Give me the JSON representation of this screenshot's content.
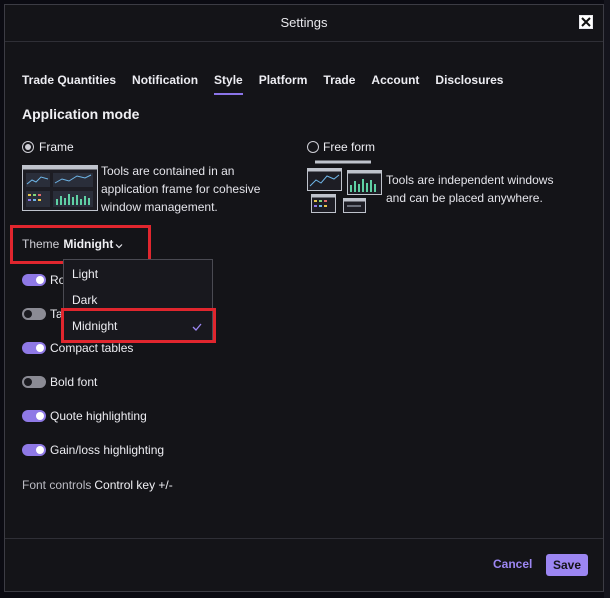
{
  "window": {
    "title": "Settings",
    "close_icon": "close-icon"
  },
  "tabs": [
    {
      "label": "Trade Quantities",
      "active": false
    },
    {
      "label": "Notification",
      "active": false
    },
    {
      "label": "Style",
      "active": true
    },
    {
      "label": "Platform",
      "active": false
    },
    {
      "label": "Trade",
      "active": false
    },
    {
      "label": "Account",
      "active": false
    },
    {
      "label": "Disclosures",
      "active": false
    }
  ],
  "application_mode": {
    "heading": "Application mode",
    "frame": {
      "label": "Frame",
      "selected": true,
      "description_lines": [
        "Tools are contained in an",
        "application frame for cohesive",
        "window management."
      ]
    },
    "free_form": {
      "label": "Free form",
      "selected": false,
      "description_lines": [
        "Tools are independent windows",
        "and can be placed anywhere."
      ]
    }
  },
  "theme": {
    "label": "Theme",
    "value": "Midnight",
    "options": [
      "Light",
      "Dark",
      "Midnight"
    ],
    "selected_option": "Midnight"
  },
  "toggles": [
    {
      "label": "Ro",
      "on": true
    },
    {
      "label": "Ta",
      "on": false
    },
    {
      "label": "Compact tables",
      "on": true
    },
    {
      "label": "Bold font",
      "on": false
    },
    {
      "label": "Quote highlighting",
      "on": true
    },
    {
      "label": "Gain/loss highlighting",
      "on": true
    }
  ],
  "font_controls": {
    "label": "Font controls",
    "value": "Control key +/-"
  },
  "footer": {
    "cancel_label": "Cancel",
    "save_label": "Save"
  },
  "colors": {
    "accent": "#9c86f2",
    "toggle_on": "#8f79e6",
    "highlight": "#e0262e",
    "background": "#141418"
  }
}
